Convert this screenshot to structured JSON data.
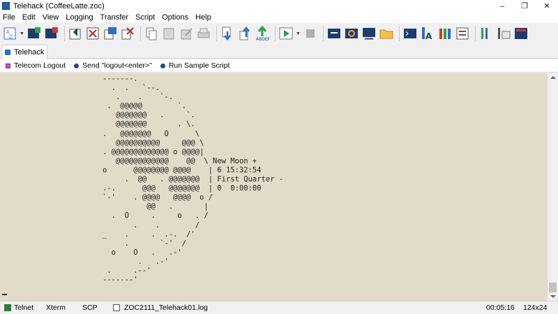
{
  "window": {
    "title": "Telehack (CoffeeLatte.zoc)",
    "controls": [
      "–",
      "❐",
      "✕"
    ]
  },
  "menu": [
    "File",
    "Edit",
    "View",
    "Logging",
    "Transfer",
    "Script",
    "Options",
    "Help"
  ],
  "toolbar": {
    "buttons": [
      "sort-icon",
      "connect-icon",
      "disconnect-icon",
      "host-directory-icon",
      "new-session-icon",
      "close-session-icon",
      "duplicate-session-icon",
      "copy-icon",
      "paste-icon",
      "edit-icon",
      "print-icon",
      "download-icon",
      "upload-icon",
      "text-send-icon",
      "run-script-icon",
      "stop-icon",
      "terminal-window-icon",
      "capture-icon",
      "screen-icon",
      "folder-icon",
      "shell-icon",
      "font-icon",
      "colors-icon",
      "keyboard-icon",
      "tools-icon",
      "options-icon",
      "news-icon"
    ]
  },
  "tabs": [
    {
      "label": "Telehack"
    }
  ],
  "quickbar": {
    "items": [
      "Telecom Logout",
      "Send \"logout<enter>\"",
      "Run Sample Script"
    ]
  },
  "terminal": {
    "lines": [
      "-------.",
      "  .  .   `--.",
      "   .    .    `-.",
      " .  @@@@@        `.",
      "   @@@@@@@   .     `.",
      "   @@@@@@@       . \\.",
      ".   @@@@@@@   O      \\",
      "   @@@@@@@@@@     @@@ \\",
      ". @@@@@@@@@@@@@ o @@@@|",
      "   @@@@@@@@@@@@    @@  \\ New Moon +",
      "o      @@@@@@@@ @@@@    | 6 15:32:54",
      "     .  @@   . @@@@@@@  | First Quarter -",
      ".-.      @@@   @@@@@@@  | 0  0:00:00",
      "`-'    . @@@@   @@@@  o /",
      "          @@   .       |",
      "  .  O     .     o   . /",
      "       .    .        /",
      "_    .     .  .-.  /'",
      "     .       `-'  /",
      "  o    O   .   .-'",
      "        .   .-'",
      " .     .--'",
      "-------'"
    ],
    "caret": "_"
  },
  "status": {
    "protocol": "Telnet",
    "emulation": "Xterm",
    "transfer": "SCP",
    "logfile": "ZOC2111_Telehack01.log",
    "elapsed": "00:05:16",
    "size": "124x24"
  },
  "colors": {
    "terminal_bg": "#e1dbc7",
    "terminal_fg": "#222222",
    "accent": "#1f5fa8"
  }
}
